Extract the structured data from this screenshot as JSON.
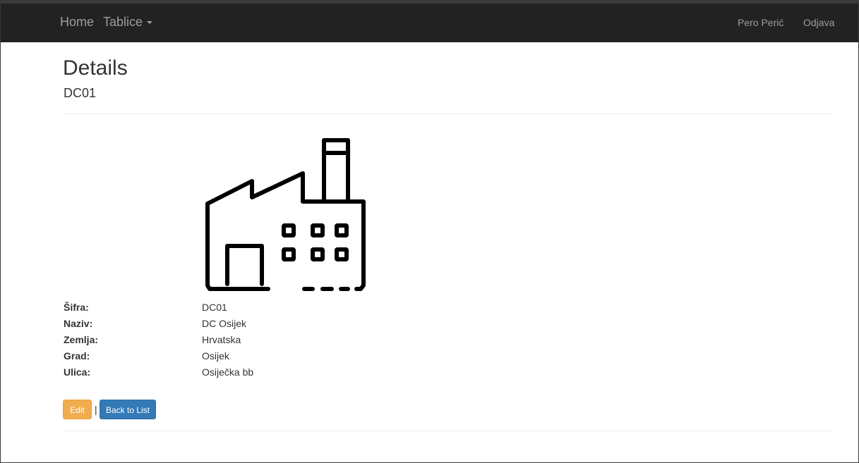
{
  "navbar": {
    "brand": "Home",
    "tables": "Tablice",
    "user": "Pero Perić",
    "logout": "Odjava"
  },
  "page": {
    "title": "Details",
    "subtitle": "DC01"
  },
  "image": {
    "icon": "factory-icon"
  },
  "details": {
    "sifra_label": "Šifra:",
    "sifra_value": "DC01",
    "naziv_label": "Naziv:",
    "naziv_value": "DC Osijek",
    "zemlja_label": "Zemlja:",
    "zemlja_value": "Hrvatska",
    "grad_label": "Grad:",
    "grad_value": "Osijek",
    "ulica_label": "Ulica:",
    "ulica_value": "Osiječka bb"
  },
  "actions": {
    "edit": "Edit",
    "separator": "|",
    "back": "Back to List"
  },
  "colors": {
    "navbar_bg": "#222222",
    "edit_btn": "#f0ad4e",
    "back_btn": "#337ab7"
  }
}
